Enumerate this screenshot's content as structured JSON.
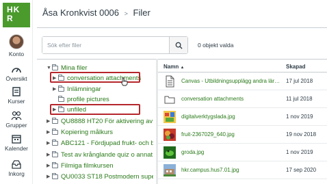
{
  "logo": {
    "line1": "HK",
    "line2": "R"
  },
  "global_nav": [
    {
      "label": "Konto",
      "icon": "avatar"
    },
    {
      "label": "Översikt",
      "icon": "dashboard-icon"
    },
    {
      "label": "Kurser",
      "icon": "courses-icon"
    },
    {
      "label": "Grupper",
      "icon": "groups-icon"
    },
    {
      "label": "Kalender",
      "icon": "calendar-icon"
    },
    {
      "label": "Inkorg",
      "icon": "inbox-icon"
    }
  ],
  "breadcrumb": {
    "user": "Åsa Kronkvist 0006",
    "separator": ">",
    "current": "Filer"
  },
  "search": {
    "placeholder": "Sök efter filer"
  },
  "selection_status": "0 objekt valda",
  "tree": [
    {
      "label": "Mina filer",
      "expanded": true,
      "level": 0
    },
    {
      "label": "conversation attachments",
      "level": 1,
      "highlighted": true
    },
    {
      "label": "Inlämningar",
      "level": 1
    },
    {
      "label": "profile pictures",
      "level": 1
    },
    {
      "label": "unfiled",
      "level": 1,
      "highlighted": true
    },
    {
      "label": "QU8888 HT20 För aktivering av s",
      "level": 0
    },
    {
      "label": "Kopiering målkurs",
      "level": 0
    },
    {
      "label": "ABC121 - Fördjupad frukt- och ba",
      "level": 0
    },
    {
      "label": "Test av krånglande quiz o annat",
      "level": 0
    },
    {
      "label": "Filmiga filmkursen",
      "level": 0
    },
    {
      "label": "QU0033 ST18 Postmodern super",
      "level": 0
    }
  ],
  "table": {
    "headers": {
      "name": "Namn",
      "sort_indicator": "▲",
      "created": "Skapad"
    },
    "rows": [
      {
        "name": "Canvas - Utbildningsupplägg andra lärosäten...",
        "created": "17 jul 2018",
        "type": "document"
      },
      {
        "name": "conversation attachments",
        "created": "11 jul 2018",
        "type": "folder"
      },
      {
        "name": "digitalverktygslada.jpg",
        "created": "1 nov 2019",
        "type": "image"
      },
      {
        "name": "fruit-2367029_640.jpg",
        "created": "19 nov 2018",
        "type": "image"
      },
      {
        "name": "groda.jpg",
        "created": "1 nov 2019",
        "type": "image"
      },
      {
        "name": "hkr.campus.hus7.01.jpg",
        "created": "17 sep 2020",
        "type": "image"
      }
    ]
  },
  "colors": {
    "brand": "#4a9a2c",
    "link": "#2a7a1a",
    "highlight": "#b5262b"
  }
}
